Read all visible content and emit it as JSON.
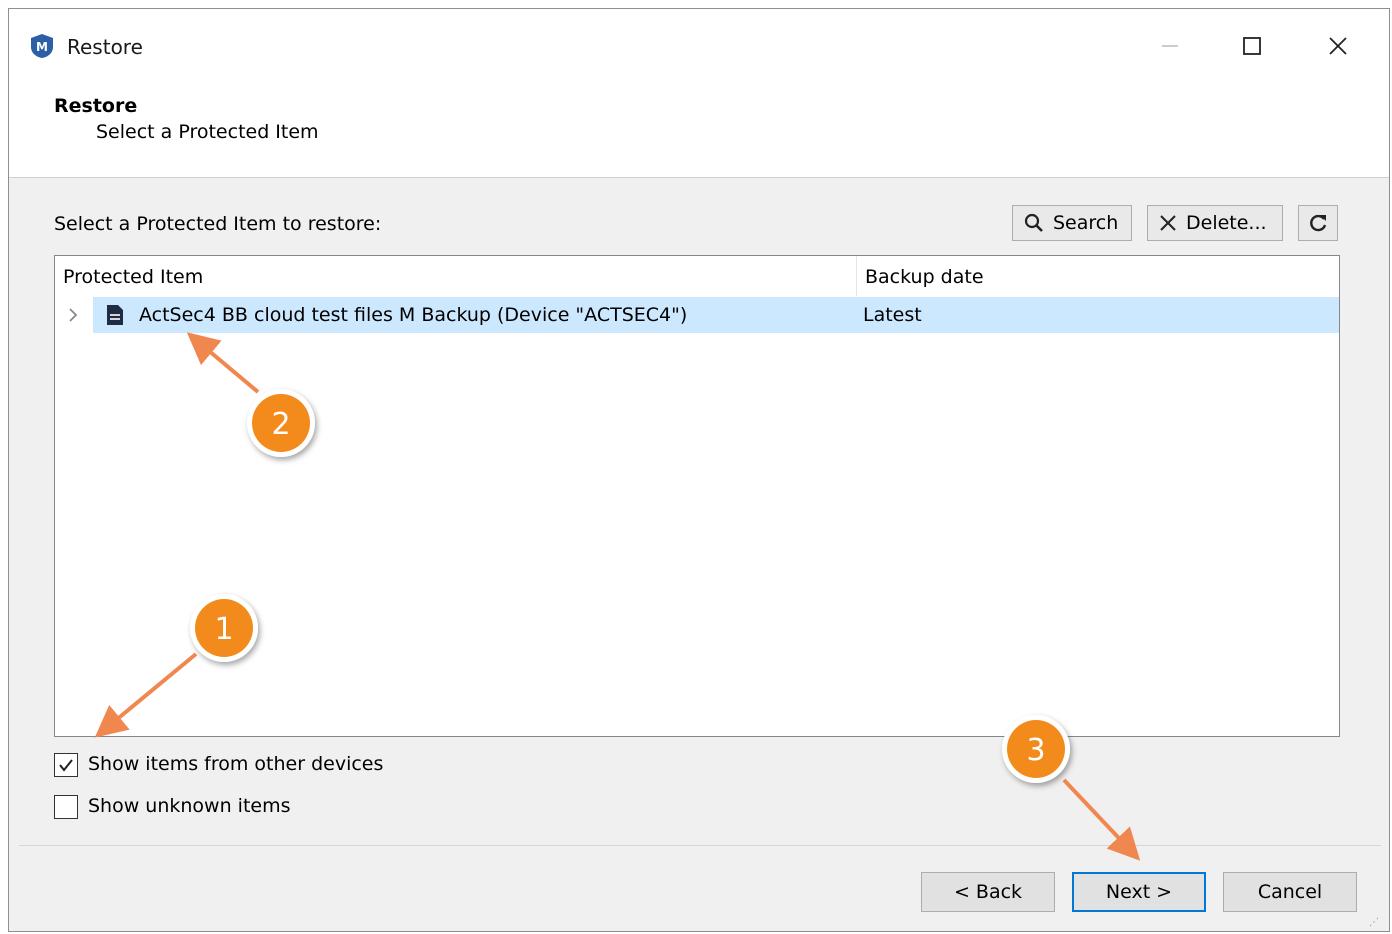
{
  "window": {
    "title": "Restore",
    "app_icon_letter": "M"
  },
  "header": {
    "title": "Restore",
    "subtitle": "Select a Protected Item"
  },
  "toolbar": {
    "prompt": "Select a Protected Item to restore:",
    "search_label": "Search",
    "delete_label": "Delete..."
  },
  "list": {
    "columns": [
      "Protected Item",
      "Backup date"
    ],
    "rows": [
      {
        "name": "ActSec4 BB cloud test files M Backup (Device \"ACTSEC4\")",
        "date": "Latest",
        "selected": true
      }
    ]
  },
  "options": {
    "show_other_devices": {
      "label": "Show items from other devices",
      "checked": true
    },
    "show_unknown": {
      "label": "Show unknown items",
      "checked": false
    }
  },
  "buttons": {
    "back": "< Back",
    "next": "Next >",
    "cancel": "Cancel"
  },
  "annotations": {
    "step1": "1",
    "step2": "2",
    "step3": "3",
    "color": "#f38b1e"
  },
  "colors": {
    "selection": "#cce8ff",
    "focus_border": "#0078d7",
    "dialog_bg": "#f0f0f0"
  }
}
